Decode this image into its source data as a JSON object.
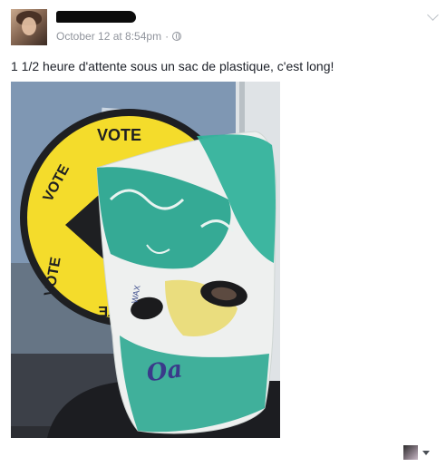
{
  "post": {
    "timestamp": "October 12 at 8:54pm",
    "separator": "·",
    "text": "1 1/2 heure d'attente sous un sac de plastique, c'est long!",
    "privacy_icon": "globe-icon",
    "options_icon": "chevron-down-icon"
  },
  "photo": {
    "sign_word": "VOTE",
    "bag_text": "WAX"
  },
  "footer": {
    "actor_icon": "avatar-thumbnail",
    "menu_icon": "caret-down-icon"
  }
}
